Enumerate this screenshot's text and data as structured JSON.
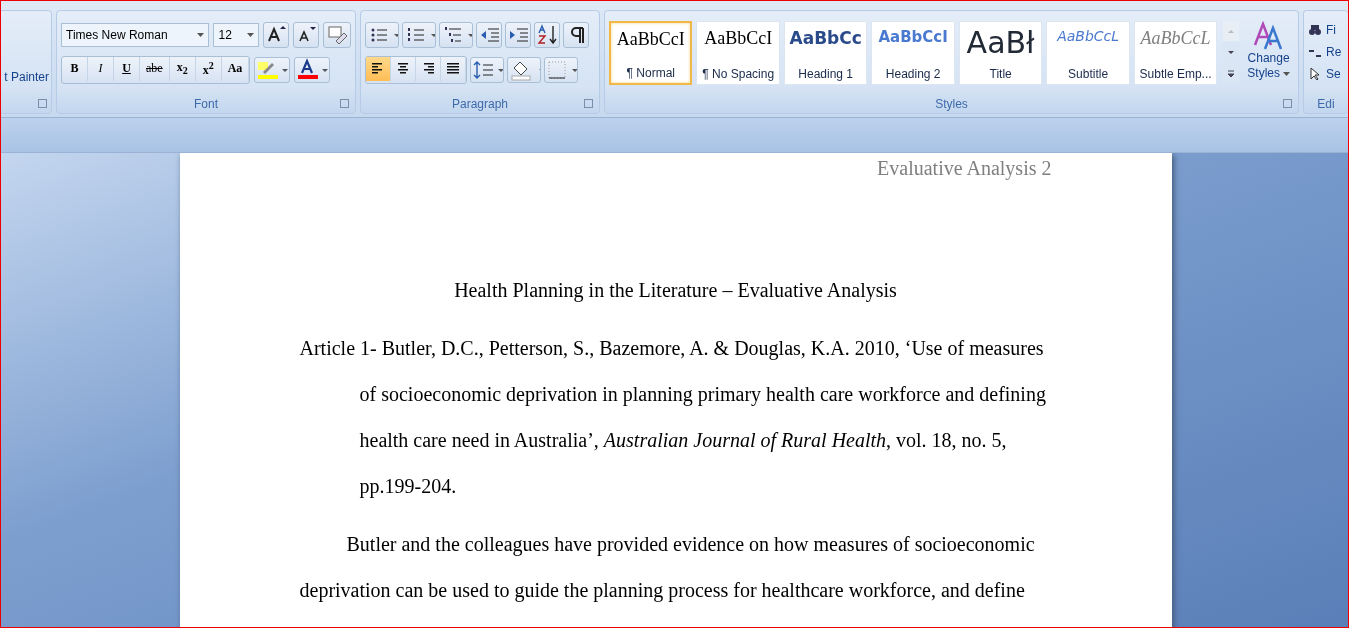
{
  "clipboard": {
    "format_painter": "t Painter"
  },
  "font": {
    "font_name": "Times New Roman",
    "font_size": "12",
    "label": "Font",
    "buttons": [
      {
        "kind": "bold",
        "text": "B"
      },
      {
        "kind": "italic",
        "text": "I"
      },
      {
        "kind": "underline",
        "text": "U"
      },
      {
        "kind": "strike",
        "text": "abe"
      },
      {
        "kind": "script",
        "text": "x$_{2}$"
      },
      {
        "kind": "script",
        "text": "x$^{2}$"
      },
      {
        "kind": "case",
        "text": "Aa"
      }
    ]
  },
  "paragraph": {
    "label": "Paragraph",
    "alignments": [
      {
        "kind": "left",
        "selected": true
      },
      {
        "kind": "center",
        "selected": false
      },
      {
        "kind": "right",
        "selected": false
      },
      {
        "kind": "justify",
        "selected": false
      }
    ]
  },
  "styles": {
    "label": "Styles",
    "items": [
      {
        "sample": "AaBbCcI",
        "label": "¶ Normal",
        "kind": "normal",
        "selected": true
      },
      {
        "sample": "AaBbCcI",
        "label": "¶ No Spacing",
        "kind": "normal",
        "selected": false
      },
      {
        "sample": "AaBbCc",
        "label": "Heading 1",
        "kind": "heading1",
        "selected": false
      },
      {
        "sample": "AaBbCcI",
        "label": "Heading 2",
        "kind": "heading2",
        "selected": false
      },
      {
        "sample": "AaBł",
        "label": "Title",
        "kind": "title",
        "selected": false
      },
      {
        "sample": "AaBbCcL",
        "label": "Subtitle",
        "kind": "subtitle",
        "selected": false
      },
      {
        "sample": "AaBbCcL",
        "label": "Subtle Emp...",
        "kind": "subtle",
        "selected": false
      }
    ],
    "change_styles": [
      "Change",
      "Styles"
    ]
  },
  "editing": {
    "label": "Edi",
    "items": [
      "Fi",
      "Re",
      "Se"
    ]
  },
  "document": {
    "header": "Evaluative Analysis 2",
    "title": "Health Planning in the Literature – Evaluative Analysis",
    "reference": "Article 1- Butler, D.C., Petterson, S., Bazemore, A. & Douglas, K.A. 2010, ‘Use of measures of socioeconomic deprivation in planning primary health care workforce and defining health care need in Australia’, *Australian Journal of Rural Health*, vol. 18, no. 5, pp.199-204.",
    "body": "Butler and the colleagues have provided evidence on how measures of socioeconomic deprivation can be used to guide the planning process for healthcare workforce, and define"
  }
}
